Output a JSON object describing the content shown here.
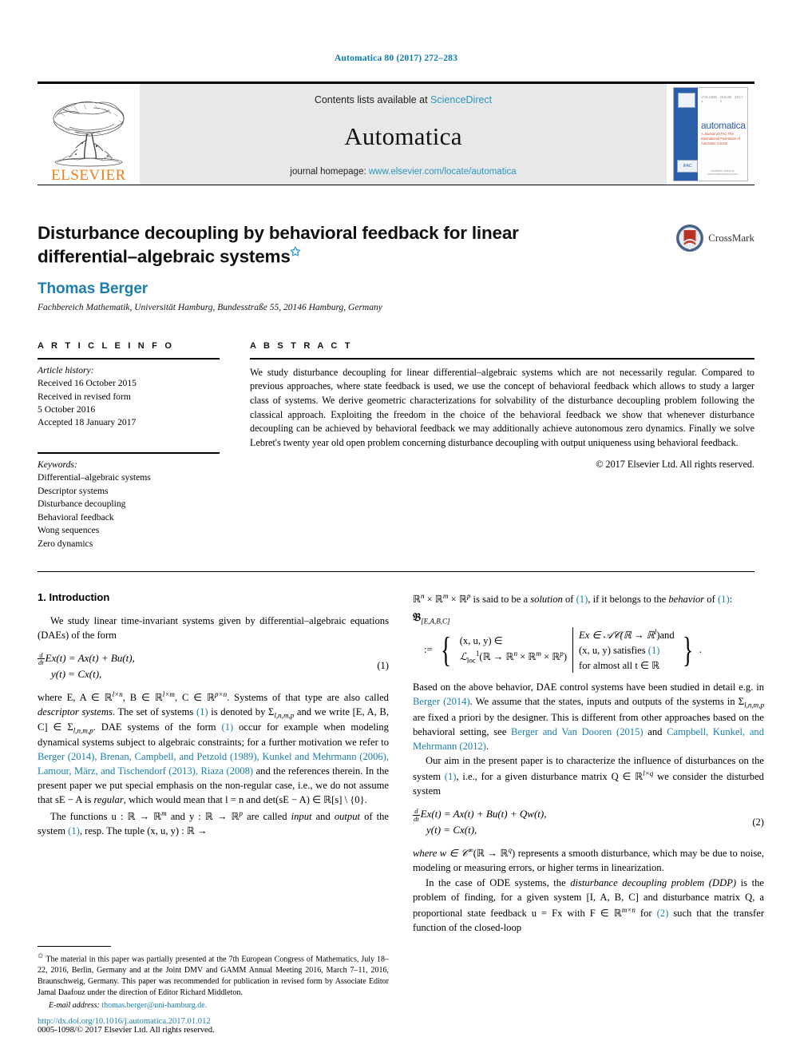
{
  "running_head": "Automatica 80 (2017) 272–283",
  "masthead": {
    "publisher_word": "ELSEVIER",
    "contents_prefix": "Contents lists available at ",
    "contents_link": "ScienceDirect",
    "journal_name": "Automatica",
    "homepage_prefix": "journal homepage: ",
    "homepage_url": "www.elsevier.com/locate/automatica",
    "cover": {
      "title": "automatica",
      "subtitle": "A Journal of IFAC The International Federation of Automatic Control",
      "top_left": "VOLUME 1",
      "top_mid": "ISSUE 1",
      "top_right": "2017",
      "badge_label": "IFAC",
      "bottom_note": "Available online at www.sciencedirect.com"
    }
  },
  "article": {
    "title_line1": "Disturbance decoupling by behavioral feedback for linear",
    "title_line2": "differential–algebraic systems",
    "title_star": "✩",
    "author": "Thomas Berger",
    "affiliation": "Fachbereich Mathematik, Universität Hamburg, Bundesstraße 55, 20146 Hamburg, Germany",
    "crossmark_label": "CrossMark"
  },
  "info": {
    "heading": "A R T I C L E   I N F O",
    "history_label": "Article history:",
    "history": [
      "Received 16 October 2015",
      "Received in revised form",
      "5 October 2016",
      "Accepted 18 January 2017"
    ],
    "keywords_label": "Keywords:",
    "keywords": [
      "Differential–algebraic systems",
      "Descriptor systems",
      "Disturbance decoupling",
      "Behavioral feedback",
      "Wong sequences",
      "Zero dynamics"
    ]
  },
  "abstract": {
    "heading": "A B S T R A C T",
    "text": "We study disturbance decoupling for linear differential–algebraic systems which are not necessarily regular. Compared to previous approaches, where state feedback is used, we use the concept of behavioral feedback which allows to study a larger class of systems. We derive geometric characterizations for solvability of the disturbance decoupling problem following the classical approach. Exploiting the freedom in the choice of the behavioral feedback we show that whenever disturbance decoupling can be achieved by behavioral feedback we may additionally achieve autonomous zero dynamics. Finally we solve Lebret's twenty year old open problem concerning disturbance decoupling with output uniqueness using behavioral feedback.",
    "copyright": "© 2017 Elsevier Ltd. All rights reserved."
  },
  "body": {
    "section1_title": "1. Introduction",
    "p1_a": "We study linear time-invariant systems given by differential–algebraic equations (DAEs) of the form",
    "eq1": {
      "line1_frac_num": "d",
      "line1_frac_den": "dt",
      "line1_rest": "Ex(t) = Ax(t) + Bu(t),",
      "line2": "y(t) = Cx(t),",
      "number": "(1)"
    },
    "p2_a": "where E, A ∈ ℝ",
    "p2_sup1": "l×n",
    "p2_b": ", B ∈ ℝ",
    "p2_sup2": "l×m",
    "p2_c": ", C ∈ ℝ",
    "p2_sup3": "p×n",
    "p2_d": ". Systems of that type are also called ",
    "p2_italic1": "descriptor systems",
    "p2_e": ". The set of systems ",
    "p2_cite1": "(1)",
    "p2_f": " is denoted by Σ",
    "p2_sub1": "l,n,m,p",
    "p2_g": " and we write [E, A, B, C] ∈ Σ",
    "p2_sub2": "l,n,m,p",
    "p2_h": ". DAE systems of the form ",
    "p2_cite2": "(1)",
    "p2_i": " occur for example when modeling dynamical systems subject to algebraic constraints; for a further motivation we refer to ",
    "p2_cites": "Berger (2014), Brenan, Campbell, and Petzold (1989), Kunkel and Mehrmann (2006), Lamour, März, and Tischendorf (2013), Riaza (2008)",
    "p2_j": " and the references therein. In the present paper we put special emphasis on the non-regular case, i.e., we do not assume that sE − A is ",
    "p2_italic2": "regular",
    "p2_k": ", which would mean that l = n and det(sE − A) ∈ ℝ[s] \\ {0}.",
    "p3": "The functions u : ℝ → ℝ",
    "p3_sup1": "m",
    "p3_b": " and y : ℝ → ℝ",
    "p3_sup2": "p",
    "p3_c": " are called ",
    "p3_italic1": "input",
    "p3_d": " and ",
    "p3_italic2": "output",
    "p3_e": " of the system ",
    "p3_cite": "(1)",
    "p3_f": ", resp. The tuple (x, u, y) : ℝ →",
    "r_p1_a": "ℝ",
    "r_p1_sup1": "n",
    "r_p1_b": " × ℝ",
    "r_p1_sup2": "m",
    "r_p1_c": " × ℝ",
    "r_p1_sup3": "p",
    "r_p1_d": " is said to be a ",
    "r_p1_italic1": "solution",
    "r_p1_e": " of ",
    "r_p1_cite1": "(1)",
    "r_p1_f": ", if it belongs to the ",
    "r_p1_italic2": "behavior",
    "r_p1_g": " of ",
    "r_p1_cite2": "(1)",
    "r_p1_h": ":",
    "setdef": {
      "symbol": "𝔅",
      "symbol_sub": "[E,A,B,C]",
      "assign": ":=",
      "left_line1": "(x, u, y) ∈",
      "left_line2_a": "ℒ",
      "left_line2_sub": "loc",
      "left_line2_sup": "1",
      "left_line2_b": "(ℝ → ℝ",
      "left_line2_sup2": "n",
      "left_line2_c": " × ℝ",
      "left_line2_sup3": "m",
      "left_line2_d": " × ℝ",
      "left_line2_sup4": "p",
      "left_line2_e": ")",
      "right_line1_a": "Ex ∈ 𝒜𝒞(ℝ → ℝ",
      "right_line1_sup": "l",
      "right_line1_b": ")and",
      "right_line2_a": "(x, u, y) satisfies ",
      "right_line2_cite": "(1)",
      "right_line3": "for almost all t ∈ ℝ",
      "trailing": "."
    },
    "r_p2_a": "Based on the above behavior, DAE control systems have been studied in detail e.g. in ",
    "r_p2_cite1": "Berger (2014)",
    "r_p2_b": ". We assume that the states, inputs and outputs of the systems in Σ",
    "r_p2_sub": "l,n,m,p",
    "r_p2_c": " are fixed a priori by the designer. This is different from other approaches based on the behavioral setting, see ",
    "r_p2_cite2": "Berger and Van Dooren (2015)",
    "r_p2_d": " and ",
    "r_p2_cite3": "Campbell, Kunkel, and Mehrmann (2012)",
    "r_p2_e": ".",
    "r_p3_a": "Our aim in the present paper is to characterize the influence of disturbances on the system ",
    "r_p3_cite": "(1)",
    "r_p3_b": ", i.e., for a given disturbance matrix Q ∈ ℝ",
    "r_p3_sup": "l×q",
    "r_p3_c": " we consider the disturbed system",
    "eq2": {
      "line1_frac_num": "d",
      "line1_frac_den": "dt",
      "line1_rest": "Ex(t) = Ax(t) + Bu(t) + Qw(t),",
      "line2": "y(t) = Cx(t),",
      "number": "(2)"
    },
    "r_p4_a": "where w ∈ 𝒞",
    "r_p4_sup1": "∞",
    "r_p4_b": "(ℝ → ℝ",
    "r_p4_sup2": "q",
    "r_p4_c": ") represents a smooth disturbance, which may be due to noise, modeling or measuring errors, or higher terms in linearization.",
    "r_p5_a": "In the case of ODE systems, the ",
    "r_p5_italic1": "disturbance decoupling problem (DDP)",
    "r_p5_b": " is the problem of finding, for a given system [I, A, B, C] and disturbance matrix Q, a proportional state feedback u = Fx with F ∈ ℝ",
    "r_p5_sup": "m×n",
    "r_p5_c": " for ",
    "r_p5_cite": "(2)",
    "r_p5_d": " such that the transfer function of the closed-loop"
  },
  "footnote": {
    "star": "✩",
    "text": "The material in this paper was partially presented at the 7th European Congress of Mathematics, July 18–22, 2016, Berlin, Germany and at the Joint DMV and GAMM Annual Meeting 2016, March 7–11, 2016, Braunschweig, Germany. This paper was recommended for publication in revised form by Associate Editor Jamal Daafouz under the direction of Editor Richard Middleton.",
    "email_label": "E-mail address:",
    "email": "thomas.berger@uni-hamburg.de.",
    "doi": "http://dx.doi.org/10.1016/j.automatica.2017.01.012",
    "issn": "0005-1098/© 2017 Elsevier Ltd. All rights reserved."
  },
  "colors": {
    "link_blue": "#1a7fae",
    "sciencedirect_blue": "#2a97c4",
    "elsevier_orange": "#ef7d1a",
    "cover_blue": "#2b5ea8",
    "crossmark_blue": "#3c5a8c",
    "crossmark_red": "#c0392b"
  }
}
